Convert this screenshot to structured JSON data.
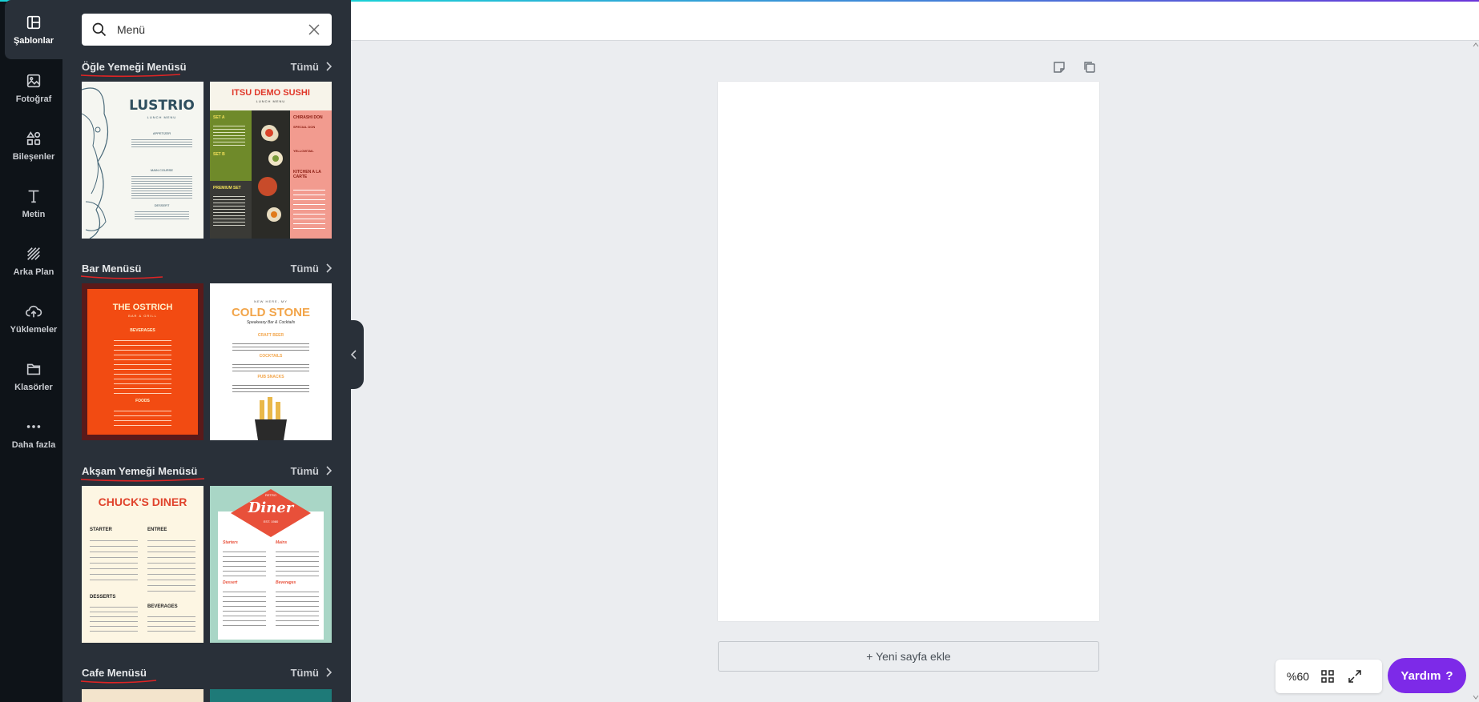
{
  "rail": {
    "items": [
      {
        "label": "Şablonlar",
        "icon": "templates-icon"
      },
      {
        "label": "Fotoğraf",
        "icon": "photo-icon"
      },
      {
        "label": "Bileşenler",
        "icon": "elements-icon"
      },
      {
        "label": "Metin",
        "icon": "text-icon"
      },
      {
        "label": "Arka Plan",
        "icon": "background-icon"
      },
      {
        "label": "Yüklemeler",
        "icon": "upload-icon"
      },
      {
        "label": "Klasörler",
        "icon": "folder-icon"
      },
      {
        "label": "Daha fazla",
        "icon": "more-icon"
      }
    ]
  },
  "search": {
    "value": "Menü",
    "placeholder": ""
  },
  "sections": [
    {
      "title": "Öğle Yemeği Menüsü",
      "all": "Tümü"
    },
    {
      "title": "Bar Menüsü",
      "all": "Tümü"
    },
    {
      "title": "Akşam Yemeği Menüsü",
      "all": "Tümü"
    },
    {
      "title": "Cafe Menüsü",
      "all": "Tümü"
    }
  ],
  "thumbs": {
    "lustrio": {
      "title": "LUSTRIO",
      "subtitle": "LUNCH MENU",
      "h1": "APPETIZER",
      "h2": "MAIN COURSE",
      "h3": "DESSERT"
    },
    "sushi": {
      "title": "ITSU DEMO SUSHI",
      "subtitle": "LUNCH MENU",
      "l1": "SET A",
      "l2": "SET B",
      "l3": "PREMIUM SET",
      "r1": "CHIRASHI DON",
      "r2": "SPECIAL DON",
      "r3": "YELLOWTAIL",
      "r4": "KITCHEN A LA CARTE"
    },
    "ostrich": {
      "title": "THE OSTRICH",
      "subtitle": "BAR & GRILL",
      "h1": "BEVERAGES",
      "h2": "FOODS"
    },
    "coldstone": {
      "pre": "NEW HERE, MY",
      "title": "COLD STONE",
      "subtitle": "Speakeasy Bar & Cocktails",
      "h1": "CRAFT BEER",
      "h2": "COCKTAILS",
      "h3": "PUB SNACKS"
    },
    "chucks": {
      "title": "CHUCK'S DINER",
      "h1": "STARTER",
      "h2": "ENTREE",
      "h3": "DESSERTS",
      "h4": "BEVERAGES"
    },
    "diner": {
      "top": "RETRO",
      "title": "Diner",
      "est": "EST. 1980",
      "h1": "Starters",
      "h2": "Mains",
      "h3": "Dessert",
      "h4": "Beverages"
    }
  },
  "canvas": {
    "add_page": "+ Yeni sayfa ekle"
  },
  "footer": {
    "zoom": "%60",
    "help": "Yardım",
    "help_mark": "?"
  }
}
